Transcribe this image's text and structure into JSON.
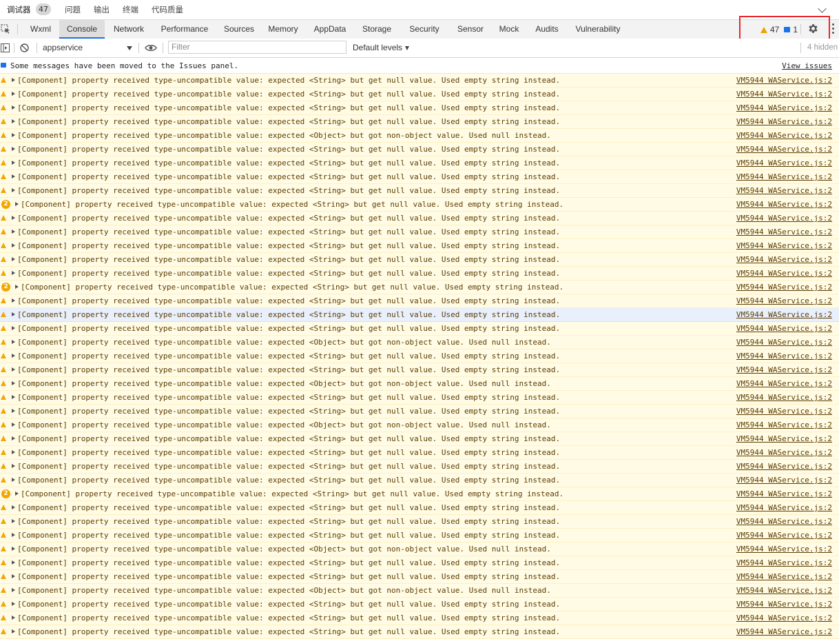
{
  "top_tabs": {
    "debugger": "调试器",
    "debugger_count": "47",
    "issues": "问题",
    "output": "输出",
    "terminal": "终端",
    "code_quality": "代码质量"
  },
  "panel_tabs": [
    "Wxml",
    "Console",
    "Network",
    "Performance",
    "Sources",
    "Memory",
    "AppData",
    "Storage",
    "Security",
    "Sensor",
    "Mock",
    "Audits",
    "Vulnerability"
  ],
  "active_panel_tab": "Console",
  "counters": {
    "warnings": "47",
    "messages": "1"
  },
  "toolbar": {
    "context": "appservice",
    "filter_placeholder": "Filter",
    "levels": "Default levels",
    "hidden": "4 hidden"
  },
  "info": {
    "text": "Some messages have been moved to the Issues panel.",
    "link": "View issues"
  },
  "colors": {
    "warning_bg": "#fffbe5",
    "warning_text": "#5c3c00",
    "selected_bg": "#e8effd",
    "accent": "#1a73e8",
    "highlight_box": "#e8262b"
  },
  "messages": [
    {
      "text": "[Component] property received type-uncompatible value: expected <String> but get null value. Used empty string instead.",
      "source": "VM5944 WAService.js:2"
    },
    {
      "text": "[Component] property received type-uncompatible value: expected <String> but get null value. Used empty string instead.",
      "source": "VM5944 WAService.js:2"
    },
    {
      "text": "[Component] property received type-uncompatible value: expected <String> but get null value. Used empty string instead.",
      "source": "VM5944 WAService.js:2"
    },
    {
      "text": "[Component] property received type-uncompatible value: expected <String> but get null value. Used empty string instead.",
      "source": "VM5944 WAService.js:2"
    },
    {
      "text": "[Component] property received type-uncompatible value: expected <Object> but got non-object value. Used null instead.",
      "source": "VM5944 WAService.js:2"
    },
    {
      "text": "[Component] property received type-uncompatible value: expected <String> but get null value. Used empty string instead.",
      "source": "VM5944 WAService.js:2"
    },
    {
      "text": "[Component] property received type-uncompatible value: expected <String> but get null value. Used empty string instead.",
      "source": "VM5944 WAService.js:2"
    },
    {
      "text": "[Component] property received type-uncompatible value: expected <String> but get null value. Used empty string instead.",
      "source": "VM5944 WAService.js:2"
    },
    {
      "text": "[Component] property received type-uncompatible value: expected <String> but get null value. Used empty string instead.",
      "source": "VM5944 WAService.js:2"
    },
    {
      "text": "[Component] property received type-uncompatible value: expected <String> but get null value. Used empty string instead.",
      "source": "VM5944 WAService.js:2",
      "repeat": "2"
    },
    {
      "text": "[Component] property received type-uncompatible value: expected <String> but get null value. Used empty string instead.",
      "source": "VM5944 WAService.js:2"
    },
    {
      "text": "[Component] property received type-uncompatible value: expected <String> but get null value. Used empty string instead.",
      "source": "VM5944 WAService.js:2"
    },
    {
      "text": "[Component] property received type-uncompatible value: expected <String> but get null value. Used empty string instead.",
      "source": "VM5944 WAService.js:2"
    },
    {
      "text": "[Component] property received type-uncompatible value: expected <String> but get null value. Used empty string instead.",
      "source": "VM5944 WAService.js:2"
    },
    {
      "text": "[Component] property received type-uncompatible value: expected <String> but get null value. Used empty string instead.",
      "source": "VM5944 WAService.js:2"
    },
    {
      "text": "[Component] property received type-uncompatible value: expected <String> but get null value. Used empty string instead.",
      "source": "VM5944 WAService.js:2",
      "repeat": "2"
    },
    {
      "text": "[Component] property received type-uncompatible value: expected <String> but get null value. Used empty string instead.",
      "source": "VM5944 WAService.js:2"
    },
    {
      "text": "[Component] property received type-uncompatible value: expected <String> but get null value. Used empty string instead.",
      "source": "VM5944 WAService.js:2",
      "selected": true
    },
    {
      "text": "[Component] property received type-uncompatible value: expected <String> but get null value. Used empty string instead.",
      "source": "VM5944 WAService.js:2"
    },
    {
      "text": "[Component] property received type-uncompatible value: expected <Object> but got non-object value. Used null instead.",
      "source": "VM5944 WAService.js:2"
    },
    {
      "text": "[Component] property received type-uncompatible value: expected <String> but get null value. Used empty string instead.",
      "source": "VM5944 WAService.js:2"
    },
    {
      "text": "[Component] property received type-uncompatible value: expected <String> but get null value. Used empty string instead.",
      "source": "VM5944 WAService.js:2"
    },
    {
      "text": "[Component] property received type-uncompatible value: expected <Object> but got non-object value. Used null instead.",
      "source": "VM5944 WAService.js:2"
    },
    {
      "text": "[Component] property received type-uncompatible value: expected <String> but get null value. Used empty string instead.",
      "source": "VM5944 WAService.js:2"
    },
    {
      "text": "[Component] property received type-uncompatible value: expected <String> but get null value. Used empty string instead.",
      "source": "VM5944 WAService.js:2"
    },
    {
      "text": "[Component] property received type-uncompatible value: expected <Object> but got non-object value. Used null instead.",
      "source": "VM5944 WAService.js:2"
    },
    {
      "text": "[Component] property received type-uncompatible value: expected <String> but get null value. Used empty string instead.",
      "source": "VM5944 WAService.js:2"
    },
    {
      "text": "[Component] property received type-uncompatible value: expected <String> but get null value. Used empty string instead.",
      "source": "VM5944 WAService.js:2"
    },
    {
      "text": "[Component] property received type-uncompatible value: expected <String> but get null value. Used empty string instead.",
      "source": "VM5944 WAService.js:2"
    },
    {
      "text": "[Component] property received type-uncompatible value: expected <String> but get null value. Used empty string instead.",
      "source": "VM5944 WAService.js:2"
    },
    {
      "text": "[Component] property received type-uncompatible value: expected <String> but get null value. Used empty string instead.",
      "source": "VM5944 WAService.js:2",
      "repeat": "2"
    },
    {
      "text": "[Component] property received type-uncompatible value: expected <String> but get null value. Used empty string instead.",
      "source": "VM5944 WAService.js:2"
    },
    {
      "text": "[Component] property received type-uncompatible value: expected <String> but get null value. Used empty string instead.",
      "source": "VM5944 WAService.js:2"
    },
    {
      "text": "[Component] property received type-uncompatible value: expected <String> but get null value. Used empty string instead.",
      "source": "VM5944 WAService.js:2"
    },
    {
      "text": "[Component] property received type-uncompatible value: expected <Object> but got non-object value. Used null instead.",
      "source": "VM5944 WAService.js:2"
    },
    {
      "text": "[Component] property received type-uncompatible value: expected <String> but get null value. Used empty string instead.",
      "source": "VM5944 WAService.js:2"
    },
    {
      "text": "[Component] property received type-uncompatible value: expected <String> but get null value. Used empty string instead.",
      "source": "VM5944 WAService.js:2"
    },
    {
      "text": "[Component] property received type-uncompatible value: expected <Object> but got non-object value. Used null instead.",
      "source": "VM5944 WAService.js:2"
    },
    {
      "text": "[Component] property received type-uncompatible value: expected <String> but get null value. Used empty string instead.",
      "source": "VM5944 WAService.js:2"
    },
    {
      "text": "[Component] property received type-uncompatible value: expected <String> but get null value. Used empty string instead.",
      "source": "VM5944 WAService.js:2"
    },
    {
      "text": "[Component] property received type-uncompatible value: expected <String> but get null value. Used empty string instead.",
      "source": "VM5944 WAService.js:2"
    }
  ]
}
